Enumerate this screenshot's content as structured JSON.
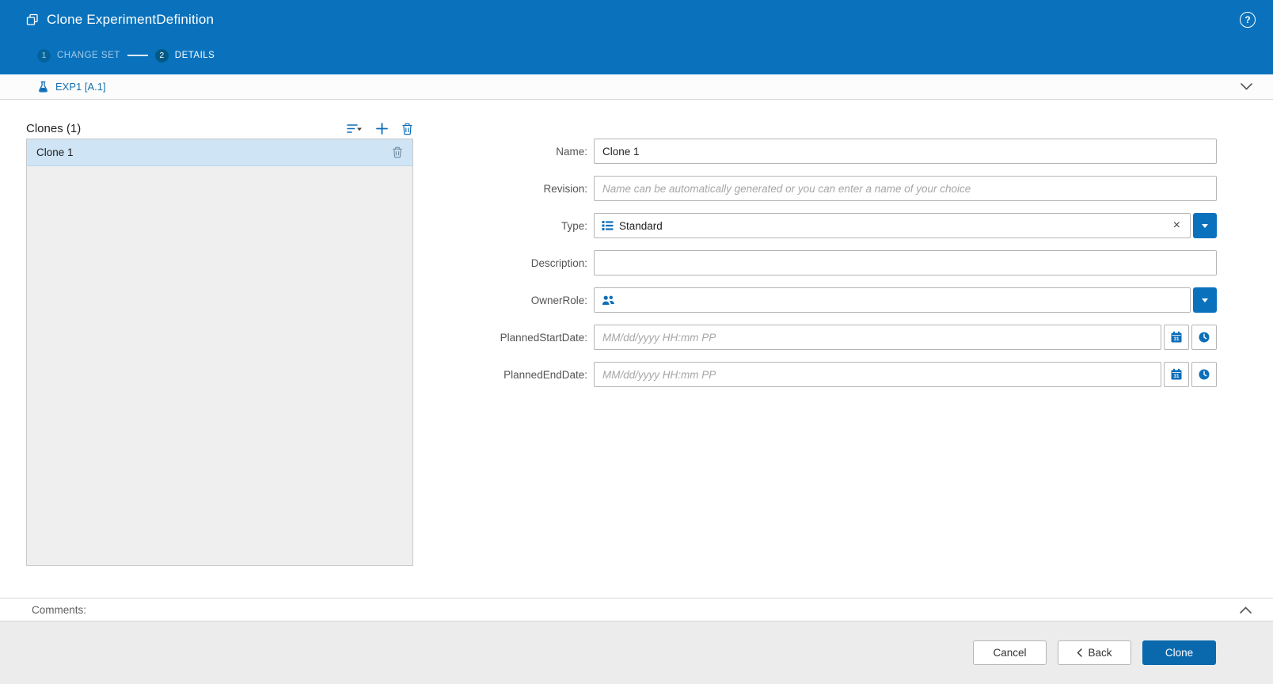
{
  "colors": {
    "header_blue": "#0a72bd",
    "accent_blue": "#0d6eb8",
    "primary_button_blue": "#0a69ad",
    "selected_row_blue": "#cfe4f4"
  },
  "header": {
    "title": "Clone ExperimentDefinition",
    "help_glyph": "?",
    "steps": [
      {
        "number": "1",
        "label": "CHANGE SET",
        "state": "inactive"
      },
      {
        "number": "2",
        "label": "DETAILS",
        "state": "active"
      }
    ]
  },
  "context_bar": {
    "item_label": "EXP1 [A.1]"
  },
  "clones_panel": {
    "title": "Clones (1)",
    "items": [
      {
        "label": "Clone 1",
        "selected": true
      }
    ]
  },
  "form": {
    "rows": [
      {
        "label": "Name:",
        "value": "Clone 1"
      },
      {
        "label": "Revision:",
        "placeholder": "Name can be automatically generated or you can enter a name of your choice"
      },
      {
        "label": "Type:",
        "value": "Standard",
        "clear_glyph": "×"
      },
      {
        "label": "Description:",
        "value": ""
      },
      {
        "label": "OwnerRole:"
      },
      {
        "label": "PlannedStartDate:",
        "placeholder": "MM/dd/yyyy HH:mm PP"
      },
      {
        "label": "PlannedEndDate:",
        "placeholder": "MM/dd/yyyy HH:mm PP"
      }
    ]
  },
  "icons": {
    "calendar_day": "31"
  },
  "comments": {
    "label": "Comments:"
  },
  "footer": {
    "cancel_label": "Cancel",
    "back_label": "Back",
    "clone_label": "Clone"
  }
}
